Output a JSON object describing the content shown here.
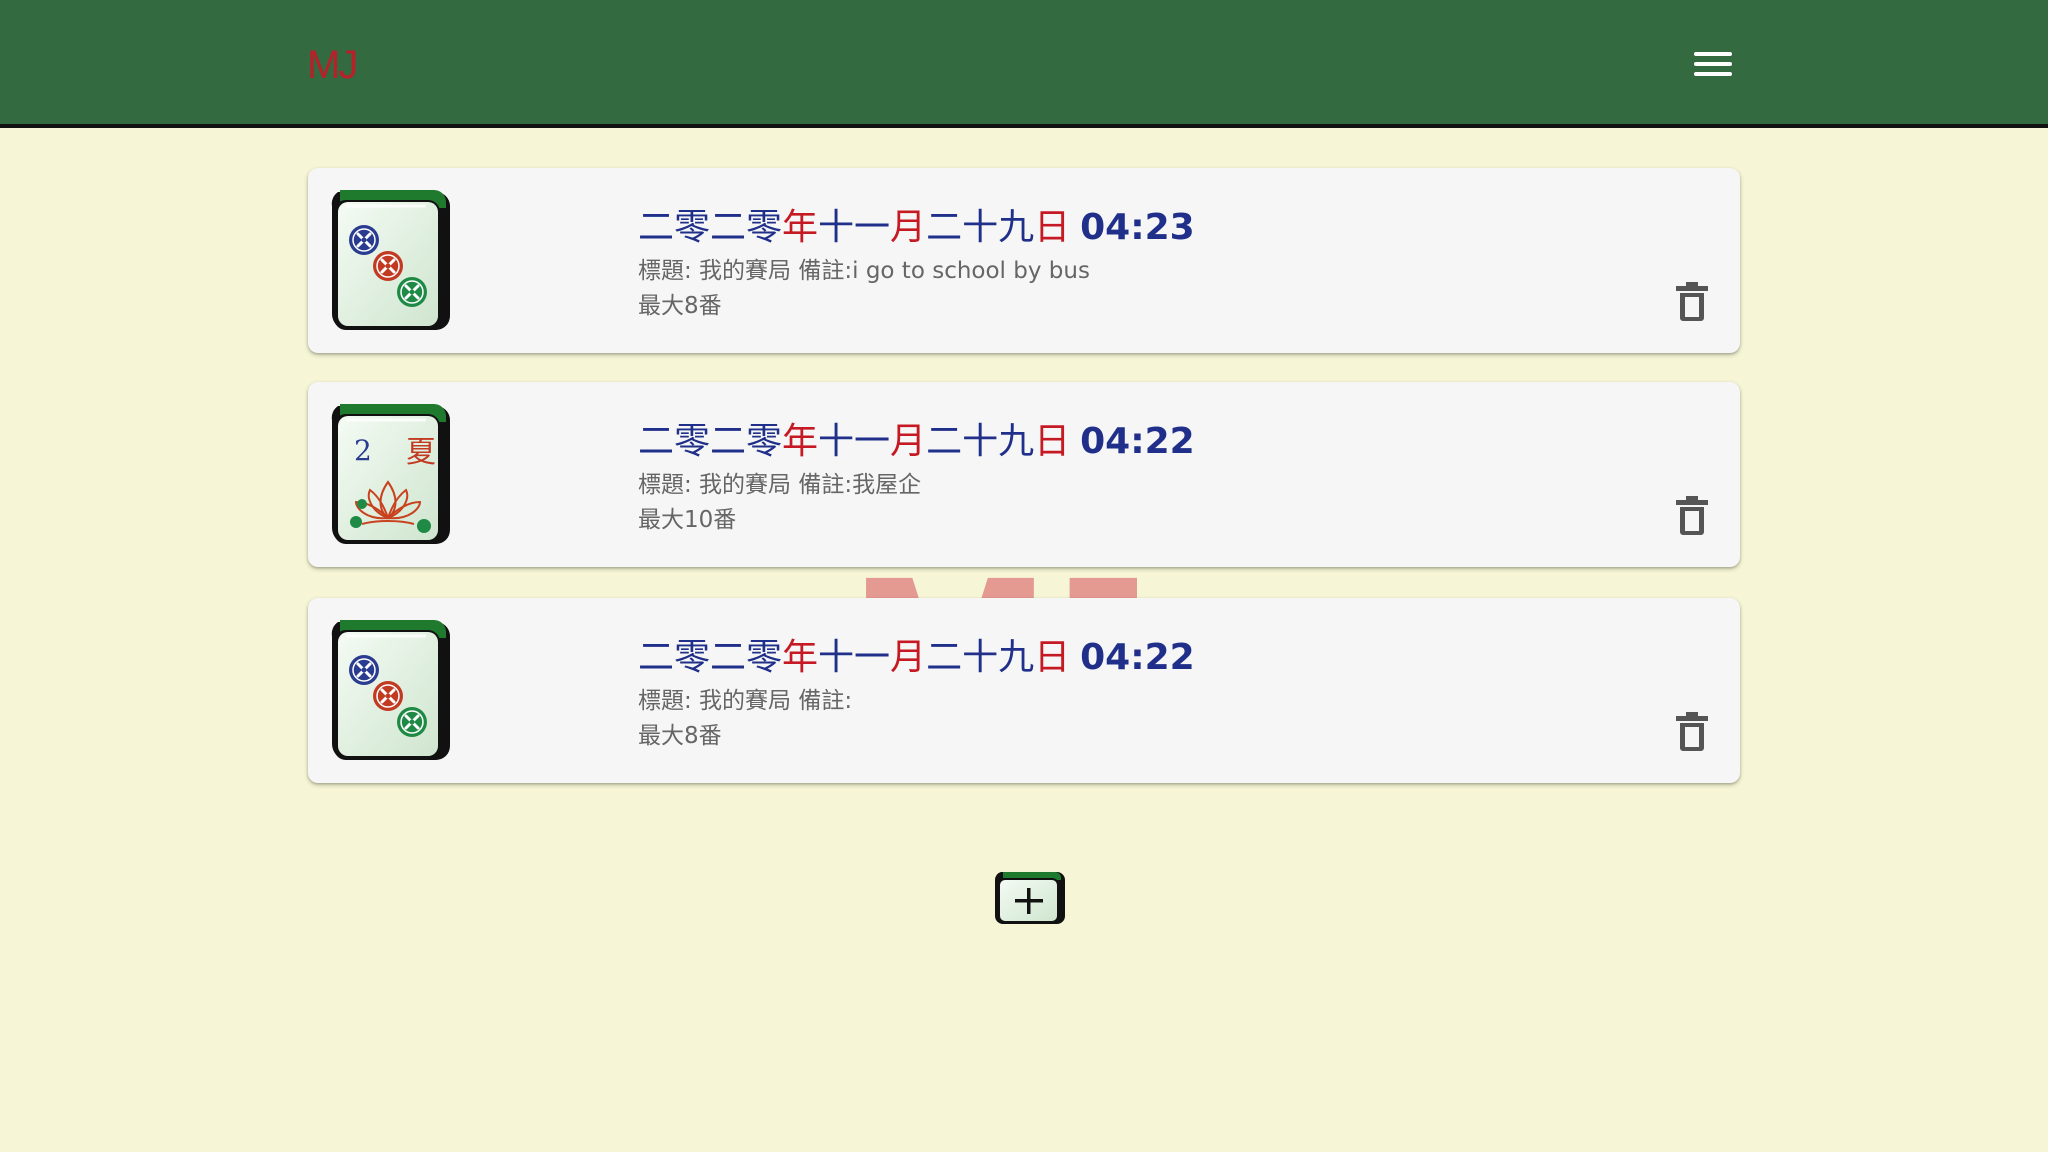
{
  "header": {
    "logo": "MJ",
    "menu_icon": "hamburger-menu-icon",
    "background_color": "#336a3f",
    "logo_color": "#b8202a"
  },
  "watermark": "MJ",
  "games": [
    {
      "date_parts": [
        "二零二零",
        "年",
        "十一",
        "月",
        "二十九",
        "日"
      ],
      "time": "04:23",
      "details": "標題: 我的賽局 備註:i go to school by bus",
      "max_fan": "最大8番",
      "tile_icon": "three-circles-mahjong-tile-icon"
    },
    {
      "date_parts": [
        "二零二零",
        "年",
        "十一",
        "月",
        "二十九",
        "日"
      ],
      "time": "04:22",
      "details": "標題: 我的賽局 備註:我屋企",
      "max_fan": "最大10番",
      "tile_icon": "summer-flower-mahjong-tile-icon",
      "tile_labels": [
        "2",
        "夏"
      ]
    },
    {
      "date_parts": [
        "二零二零",
        "年",
        "十一",
        "月",
        "二十九",
        "日"
      ],
      "time": "04:22",
      "details": "標題: 我的賽局 備註:",
      "max_fan": "最大8番",
      "tile_icon": "three-circles-mahjong-tile-icon"
    }
  ],
  "delete_icon": "trash-icon",
  "add_button_icon": "plus-tile-icon",
  "colors": {
    "page_background": "#f6f6d6",
    "date_blue": "#1f2f8a",
    "date_red": "#c51a24",
    "tile_green": "#1f7a2e"
  }
}
